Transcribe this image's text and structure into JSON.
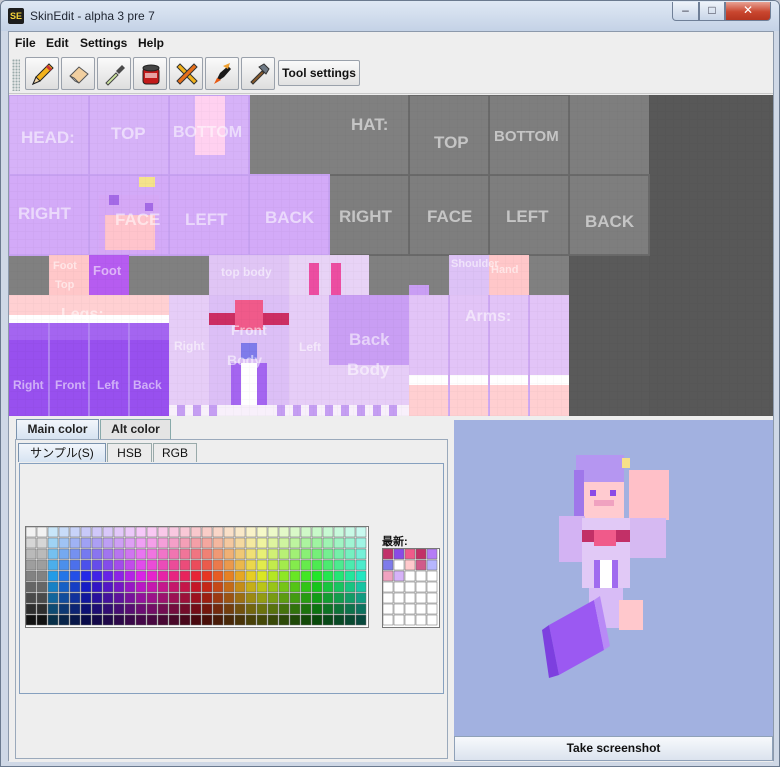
{
  "window": {
    "title": "SkinEdit - alpha 3 pre 7",
    "app_icon": "SE"
  },
  "menu": [
    "File",
    "Edit",
    "Settings",
    "Help"
  ],
  "toolbar": {
    "tools": [
      {
        "name": "pencil-icon"
      },
      {
        "name": "eraser-icon"
      },
      {
        "name": "eyedropper-icon"
      },
      {
        "name": "paint-bucket-icon"
      },
      {
        "name": "pencil-ruler-icon"
      },
      {
        "name": "brush-icon"
      },
      {
        "name": "hammer-icon"
      }
    ],
    "tool_settings_label": "Tool settings"
  },
  "skin_labels": {
    "head": "HEAD:",
    "top": "TOP",
    "bottom": "BOTTOM",
    "hat": "HAT:",
    "hat_top": "TOP",
    "hat_bottom": "BOTTOM",
    "right": "RIGHT",
    "face": "FACE",
    "left": "LEFT",
    "back": "BACK",
    "hat_right": "RIGHT",
    "hat_face": "FACE",
    "hat_left": "LEFT",
    "hat_back": "BACK",
    "foot1": "Foot",
    "foot2": "Foot",
    "foot_top": "Top",
    "top_body": "top body",
    "shoulder": "Shoulder",
    "hand": "Hand",
    "legs": "Legs:",
    "arms": "Arms:",
    "leg_right": "Right",
    "leg_front": "Front",
    "leg_left": "Left",
    "leg_back": "Back",
    "body_right": "Right",
    "body_front": "Front",
    "body_body": "Body",
    "body_left": "Left",
    "back_body1": "Back",
    "back_body2": "Body"
  },
  "color_tabs": {
    "main": "Main color",
    "alt": "Alt color"
  },
  "chooser_tabs": {
    "swatches": "サンプル(S)",
    "hsb": "HSB",
    "rgb": "RGB"
  },
  "recent_label": "最新:",
  "screenshot_label": "Take screenshot",
  "colors": {
    "accent": "#b57cf6",
    "skin_light": "#d9b3fa",
    "pink": "#ffc9cc",
    "magenta": "#cc2e63",
    "hat_grey": "#808080",
    "preview_bg": "#a2b1e0"
  }
}
